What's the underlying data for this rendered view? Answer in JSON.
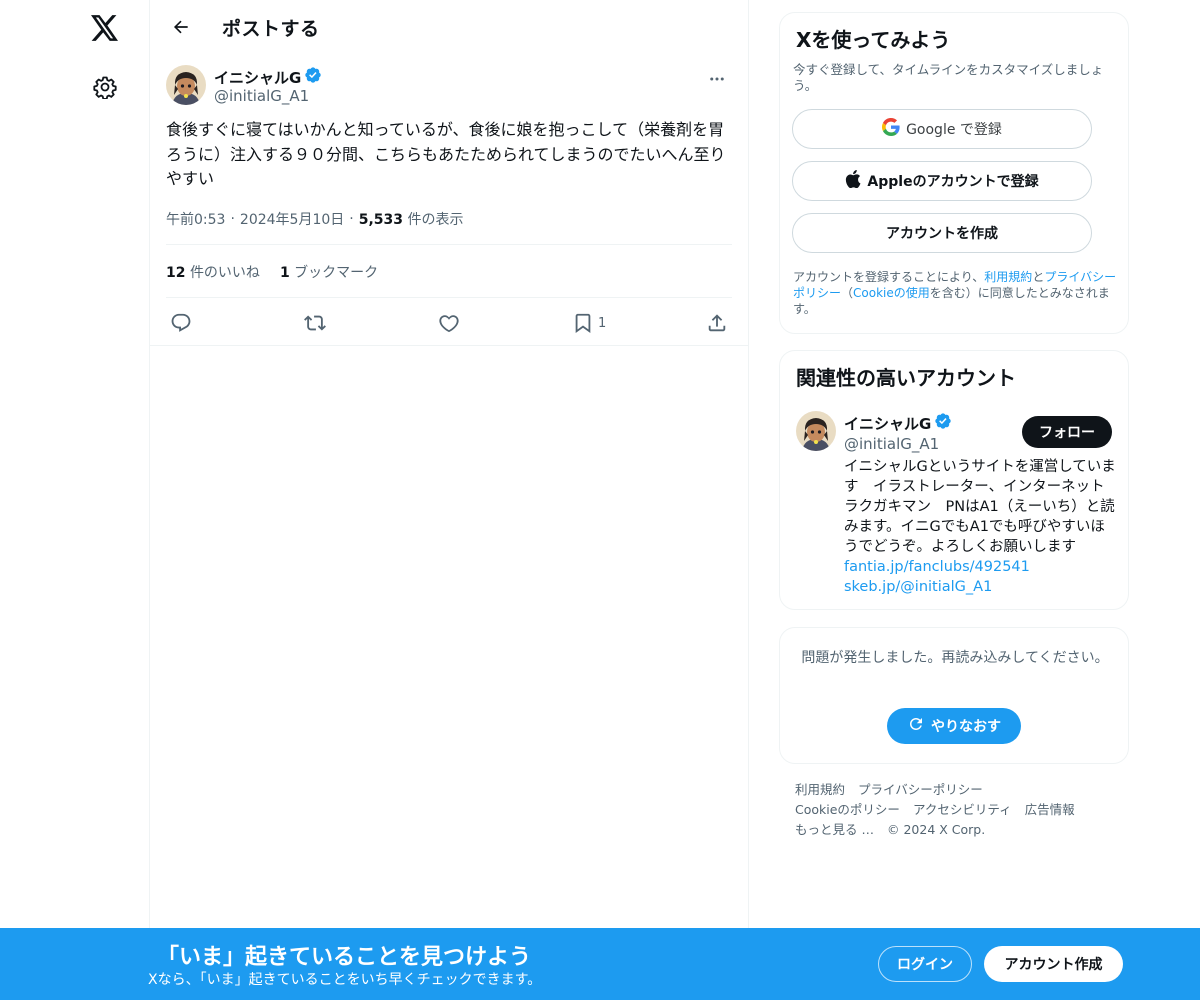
{
  "colors": {
    "accent": "#1d9bf0",
    "text_primary": "#0f1419",
    "text_secondary": "#536471",
    "border": "#eff3f4",
    "follow_button": "#0f1419"
  },
  "nav": {
    "logo_icon": "x-logo-icon",
    "settings_icon": "gear-icon"
  },
  "header": {
    "back_icon": "arrow-left-icon",
    "title": "ポストする"
  },
  "post": {
    "author_name": "イニシャルG",
    "verified_icon": "verified-badge-icon",
    "author_handle": "@initialG_A1",
    "more_icon": "more-horizontal-icon",
    "text": "食後すぐに寝てはいかんと知っているが、食後に娘を抱っこして（栄養剤を胃ろうに）注入する９０分間、こちらもあたためられてしまうのでたいへん至りやすい",
    "time": "午前0:53",
    "sep1": "·",
    "date": "2024年5月10日",
    "sep2": "·",
    "views_count": "5,533",
    "views_label": "件の表示",
    "likes_count": "12",
    "likes_label": "件のいいね",
    "bookmarks_count": "1",
    "bookmarks_label": "ブックマーク",
    "actions": {
      "reply_icon": "reply-icon",
      "repost_icon": "repost-icon",
      "like_icon": "heart-icon",
      "bookmark_icon": "bookmark-icon",
      "bookmark_count": "1",
      "share_icon": "share-icon"
    }
  },
  "signup_card": {
    "title": "Xを使ってみよう",
    "subtitle": "今すぐ登録して、タイムラインをカスタマイズしましょう。",
    "google_brand": "Google",
    "google_suffix": " で登録",
    "apple_label": "Appleのアカウントで登録",
    "create_label": "アカウントを作成",
    "legal_prefix": "アカウントを登録することにより、",
    "legal_terms": "利用規約",
    "legal_and": "と",
    "legal_privacy": "プライバシーポリシー",
    "legal_open": "（",
    "legal_cookie": "Cookieの使用",
    "legal_suffix": "を含む）に同意したとみなされます。"
  },
  "related_card": {
    "title": "関連性の高いアカウント",
    "name": "イニシャルG",
    "handle": "@initialG_A1",
    "follow_label": "フォロー",
    "bio": "イニシャルGというサイトを運営しています　イラストレーター、インターネットラクガキマン　PNはA1（えーいち）と読みます。イニGでもA1でも呼びやすいほうでどうぞ。よろしくお願いします ",
    "link1": "fantia.jp/fanclubs/492541",
    "link2": "skeb.jp/@initialG_A1"
  },
  "error_card": {
    "message": "問題が発生しました。再読み込みしてください。",
    "retry_label": "やりなおす",
    "retry_icon": "refresh-icon"
  },
  "footer": {
    "terms": "利用規約",
    "privacy": "プライバシーポリシー",
    "cookie": "Cookieのポリシー",
    "accessibility": "アクセシビリティ",
    "ads": "広告情報",
    "more": "もっと見る …",
    "copyright": "© 2024 X Corp."
  },
  "bottom_bar": {
    "title": "「いま」起きていることを見つけよう",
    "subtitle": "Xなら、「いま」起きていることをいち早くチェックできます。",
    "login_label": "ログイン",
    "signup_label": "アカウント作成"
  }
}
